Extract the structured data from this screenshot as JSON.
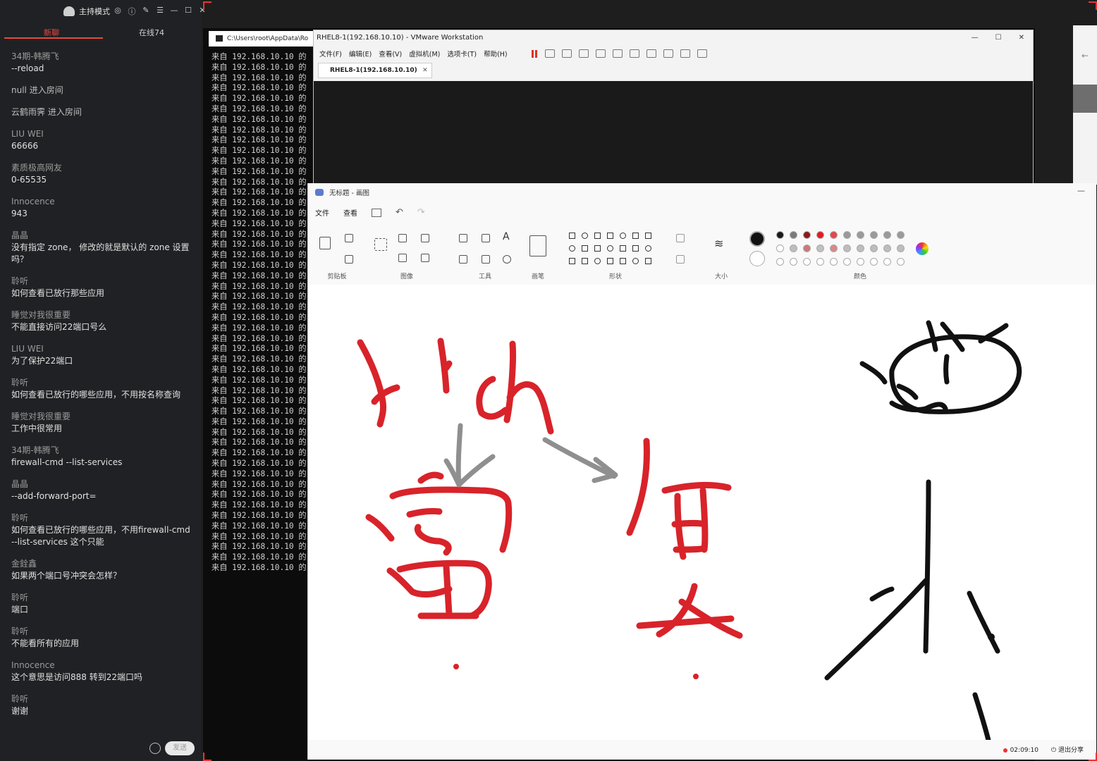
{
  "chat": {
    "mode_label": "主持模式",
    "tabs": {
      "new": "新聊",
      "online": "在线74"
    },
    "messages": [
      {
        "name": "34期-韩腾飞",
        "text": "--reload"
      },
      {
        "join": "null 进入房间"
      },
      {
        "join": "云鹤雨霁 进入房间"
      },
      {
        "name": "LIU WEI",
        "text": "66666"
      },
      {
        "name": "素质极高网友",
        "text": "0-65535"
      },
      {
        "name": "Innocence",
        "text": "943"
      },
      {
        "name": "晶晶",
        "text": "没有指定 zone， 修改的就是默认的 zone 设置吗？"
      },
      {
        "name": "聆听",
        "text": "如何查看已放行那些应用"
      },
      {
        "name": "睡觉对我很重要",
        "text": "不能直接访问22端口号么"
      },
      {
        "name": "LIU WEI",
        "text": "为了保护22端口"
      },
      {
        "name": "聆听",
        "text": "如何查看已放行的哪些应用，不用按名称查询"
      },
      {
        "name": "睡觉对我很重要",
        "text": "工作中很常用"
      },
      {
        "name": "34期-韩腾飞",
        "text": "firewall-cmd --list-services"
      },
      {
        "name": "晶晶",
        "text": "--add-forward-port="
      },
      {
        "name": "聆听",
        "text": "如何查看已放行的哪些应用，不用firewall-cmd --list-services 这个只能"
      },
      {
        "name": "金銓鑫",
        "text": "如果两个端口号冲突会怎样？"
      },
      {
        "name": "聆听",
        "text": "端口"
      },
      {
        "name": "聆听",
        "text": "不能看所有的应用"
      },
      {
        "name": "Innocence",
        "text": "这个意思是访问888 转到22端口吗"
      },
      {
        "name": "聆听",
        "text": "谢谢"
      }
    ],
    "send_label": "发送"
  },
  "terminal": {
    "title": "C:\\Users\\root\\AppData\\Ro",
    "line_text": "来自 192.168.10.10 的",
    "line_count": 50
  },
  "vmware": {
    "title": "RHEL8-1(192.168.10.10) - VMware Workstation",
    "menu": [
      "文件(F)",
      "编辑(E)",
      "查看(V)",
      "虚拟机(M)",
      "选项卡(T)",
      "帮助(H)"
    ],
    "tab_label": "RHEL8-1(192.168.10.10)"
  },
  "paint": {
    "title": "无标题 - 画图",
    "menu": [
      "文件",
      "查看"
    ],
    "groups": [
      "剪贴板",
      "图像",
      "工具",
      "画笔",
      "形状",
      "大小",
      "颜色"
    ],
    "palette_row1": [
      "#1a1a1a",
      "#7a7a7a",
      "#8b1a1a",
      "#e31b23",
      "#e8454b",
      "#9a9a9a",
      "#9a9a9a",
      "#9a9a9a",
      "#9a9a9a",
      "#9a9a9a"
    ],
    "palette_row2": [
      "#ffffff",
      "#bdbdbd",
      "#c97a7a",
      "#c0c0c0",
      "#d98888",
      "#bdbdbd",
      "#bdbdbd",
      "#bdbdbd",
      "#bdbdbd",
      "#bdbdbd"
    ],
    "stroke_red": "#d8232a",
    "stroke_black": "#111111",
    "status": {
      "time": "02:09:10",
      "exit": "退出分享"
    }
  },
  "colors": {
    "accent": "#e64a3b"
  }
}
